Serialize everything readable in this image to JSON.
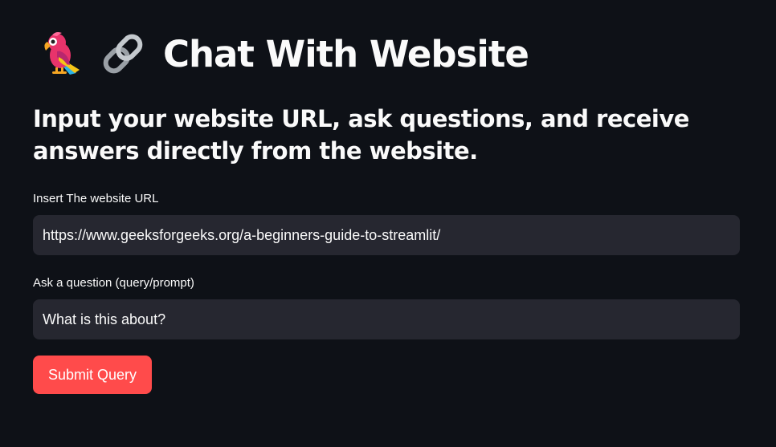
{
  "header": {
    "title": "Chat With Website",
    "icons": [
      "parrot-icon",
      "link-icon"
    ]
  },
  "subtitle": "Input your website URL, ask questions, and receive answers directly from the website.",
  "form": {
    "url_label": "Insert The website URL",
    "url_value": "https://www.geeksforgeeks.org/a-beginners-guide-to-streamlit/",
    "question_label": "Ask a question (query/prompt)",
    "question_value": "What is this about?",
    "submit_label": "Submit Query"
  },
  "colors": {
    "background": "#0e1117",
    "input_bg": "#262730",
    "accent": "#ff4b4b",
    "text": "#fafafa"
  }
}
